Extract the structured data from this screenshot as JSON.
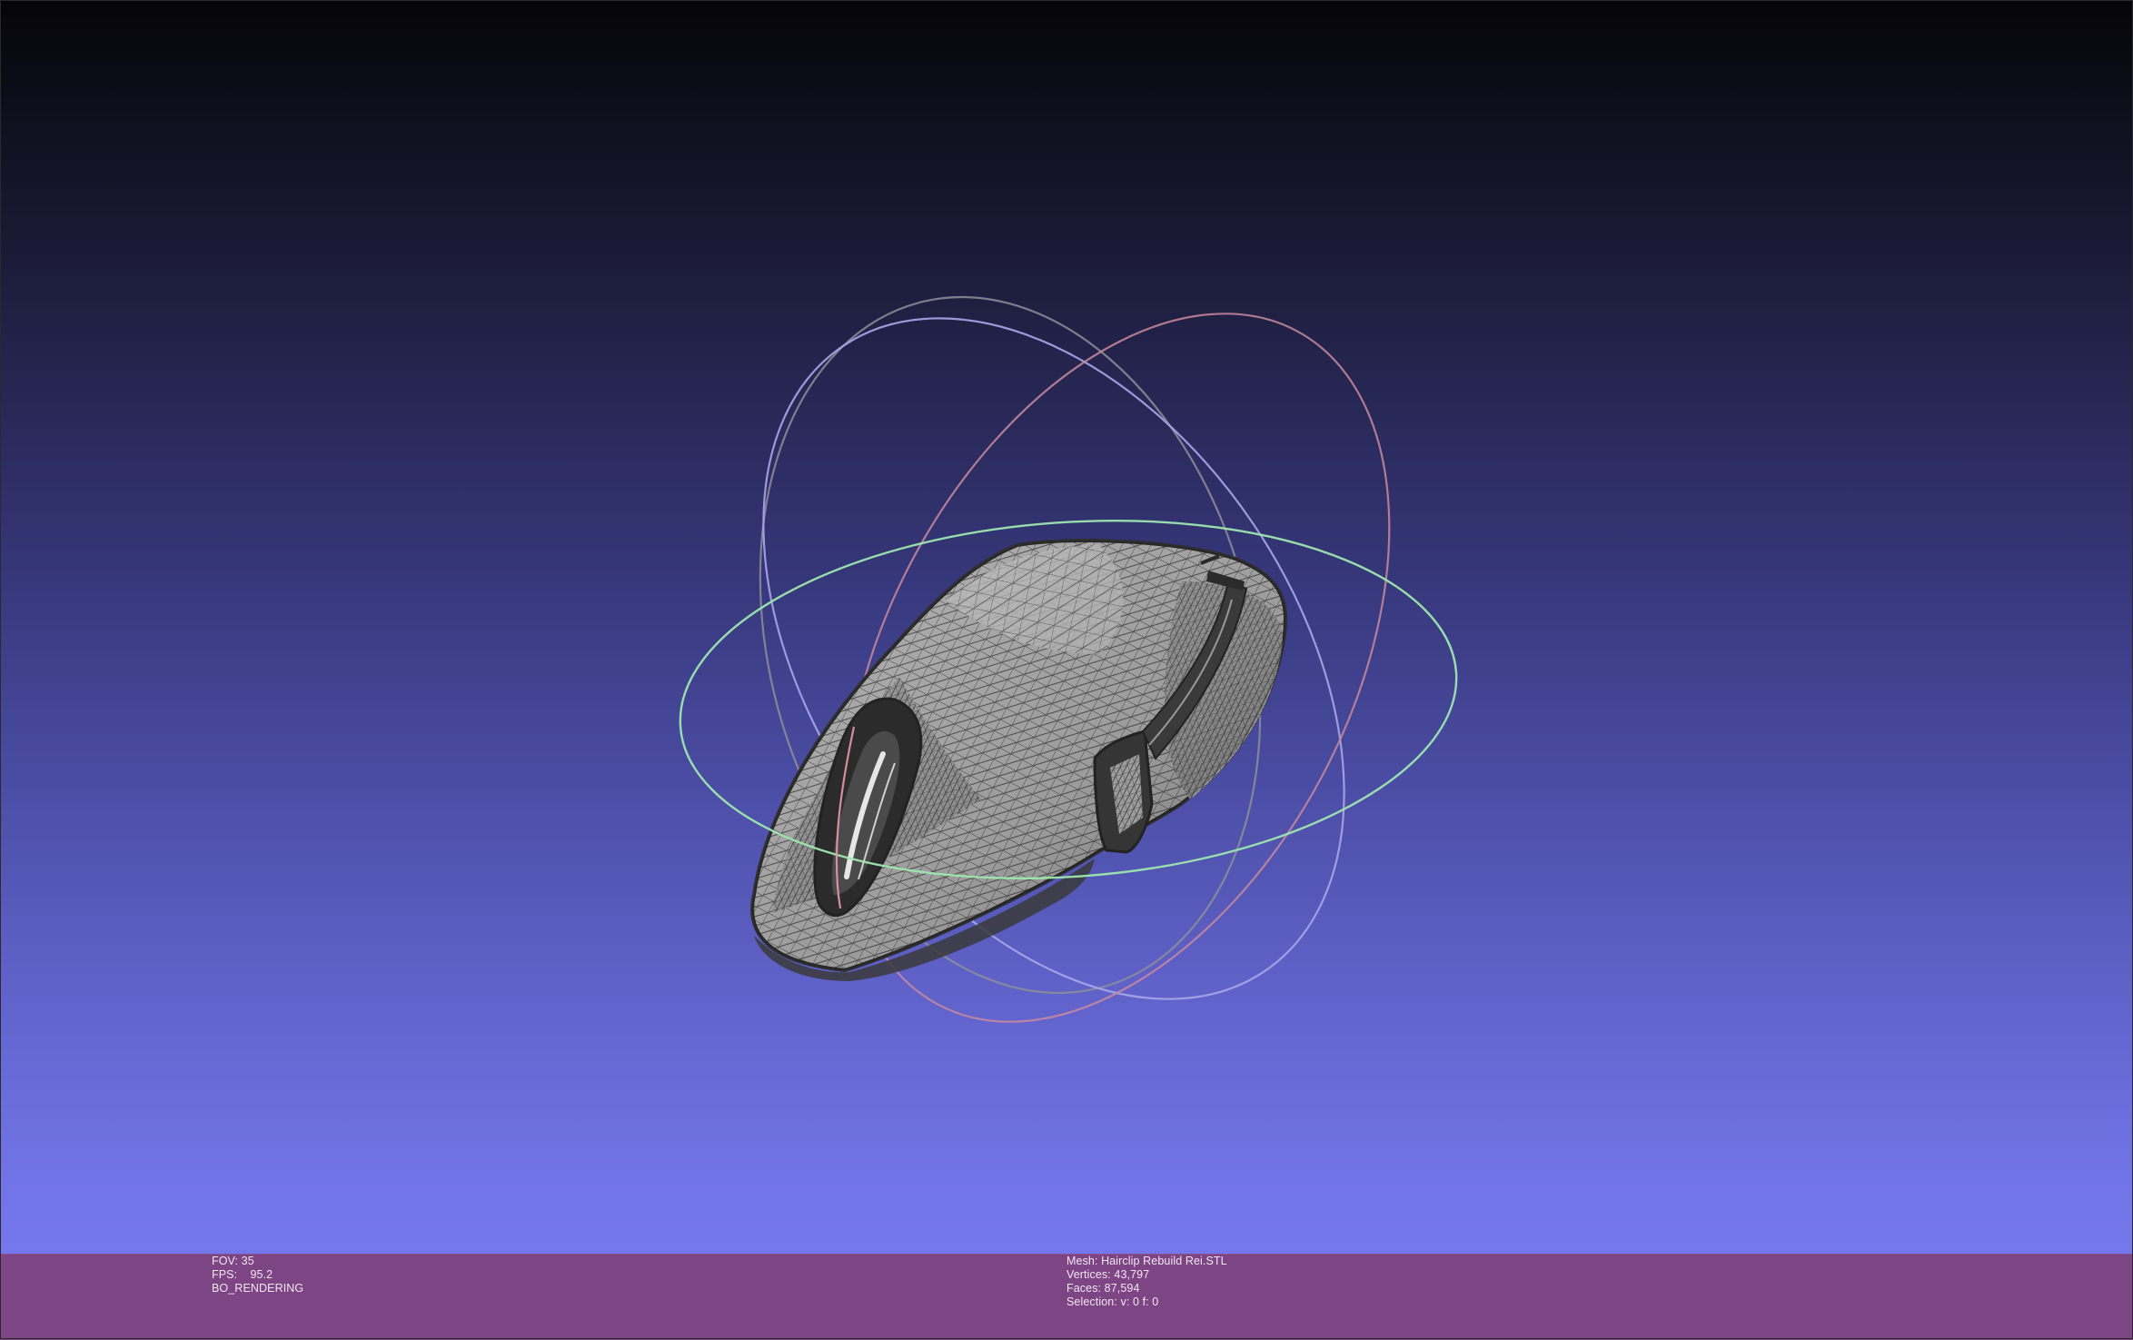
{
  "render_info": {
    "fov": "FOV: 35",
    "fps": "FPS:    95.2",
    "mode": "BO_RENDERING"
  },
  "mesh_info": {
    "mesh": "Mesh: Hairclip Rebuild Rei.STL",
    "vertices": "Vertices: 43,797",
    "faces": "Faces: 87,594",
    "selection": "Selection: v: 0 f: 0"
  },
  "colors": {
    "statusbar": "#7e4584",
    "trackball_red": "#e89aa6",
    "trackball_green": "#9ee6b0",
    "trackball_blue": "#b8b8ff",
    "mesh_fill": "#b9b9b9",
    "mesh_wire": "#3a3a3a"
  },
  "icons": {
    "trackball": "trackball-gizmo",
    "mesh": "wireframe-mesh"
  }
}
